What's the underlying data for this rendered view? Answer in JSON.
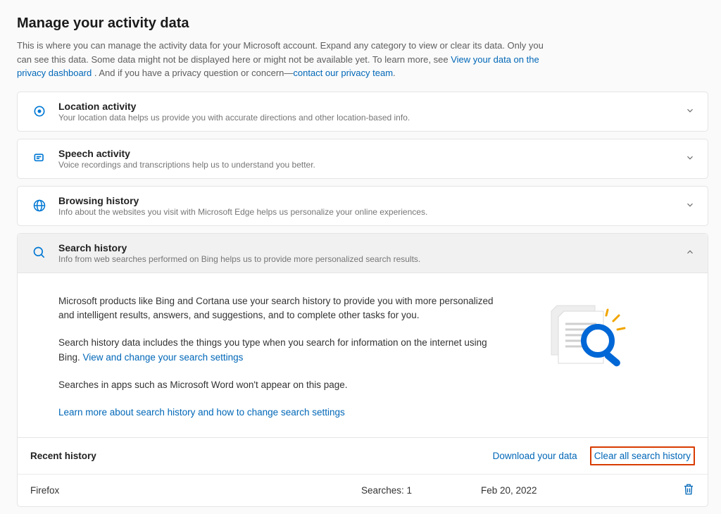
{
  "title": "Manage your activity data",
  "intro": {
    "p1a": "This is where you can manage the activity data for your Microsoft account. Expand any category to view or clear its data. Only you can see this data. Some data might not be displayed here or might not be available yet. To learn more, see ",
    "link1": "View your data on the privacy dashboard",
    "p1b": ". And if you have a privacy question or concern—",
    "link2": "contact our privacy team",
    "p1c": "."
  },
  "cards": {
    "location": {
      "title": "Location activity",
      "sub": "Your location data helps us provide you with accurate directions and other location-based info."
    },
    "speech": {
      "title": "Speech activity",
      "sub": "Voice recordings and transcriptions help us to understand you better."
    },
    "browsing": {
      "title": "Browsing history",
      "sub": "Info about the websites you visit with Microsoft Edge helps us personalize your online experiences."
    },
    "search": {
      "title": "Search history",
      "sub": "Info from web searches performed on Bing helps us to provide more personalized search results."
    }
  },
  "searchPanel": {
    "p1": "Microsoft products like Bing and Cortana use your search history to provide you with more personalized and intelligent results, answers, and suggestions, and to complete other tasks for you.",
    "p2a": "Search history data includes the things you type when you search for information on the internet using Bing. ",
    "p2link": "View and change your search settings",
    "p3": "Searches in apps such as Microsoft Word won't appear on this page.",
    "learnMore": "Learn more about search history and how to change search settings"
  },
  "recent": {
    "title": "Recent history",
    "download": "Download your data",
    "clear": "Clear all search history"
  },
  "historyRow": {
    "name": "Firefox",
    "count": "Searches: 1",
    "date": "Feb 20, 2022"
  }
}
